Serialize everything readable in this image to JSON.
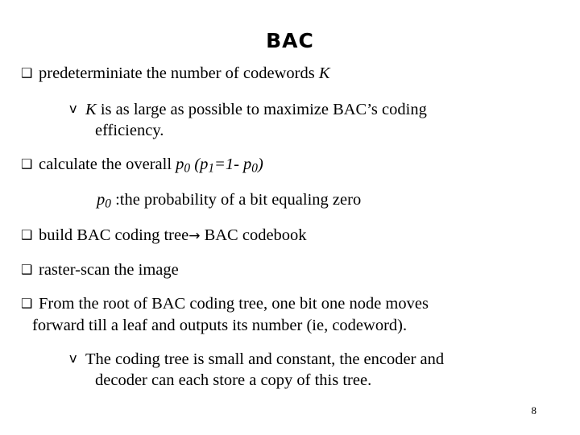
{
  "slide": {
    "title": "BAC",
    "page_number": "8",
    "bullet_glyph_square": "❑",
    "bullet_glyph_diamond": "v",
    "arrow_glyph": "→",
    "items": {
      "b1": "predeterminiate the number of codewords ",
      "b1_italic": "K",
      "b2_a": "K",
      "b2_b": " is as large as possible to maximize BAC’s coding",
      "b2_c": "efficiency.",
      "b3_a": "calculate the overall ",
      "b3_p0": "p",
      "b3_p0_sub": "0",
      "b3_mid": " (",
      "b3_p1": "p",
      "b3_p1_sub": "1",
      "b3_eq": "=1- ",
      "b3_p0b": "p",
      "b3_p0b_sub": "0",
      "b3_end": ")",
      "b4_p0": "p",
      "b4_p0_sub": "0",
      "b4_rest": " :the probability of a bit equaling zero",
      "b5_a": "build BAC coding tree",
      "b5_b": " BAC codebook",
      "b6": "raster-scan the image",
      "b7_a": "From the root of BAC coding tree, one bit one node moves",
      "b7_b": "forward  till a leaf and outputs its number (ie, codeword).",
      "b8_a": "The coding tree is small and constant, the encoder and",
      "b8_b": "decoder can each store a copy of this tree."
    }
  }
}
